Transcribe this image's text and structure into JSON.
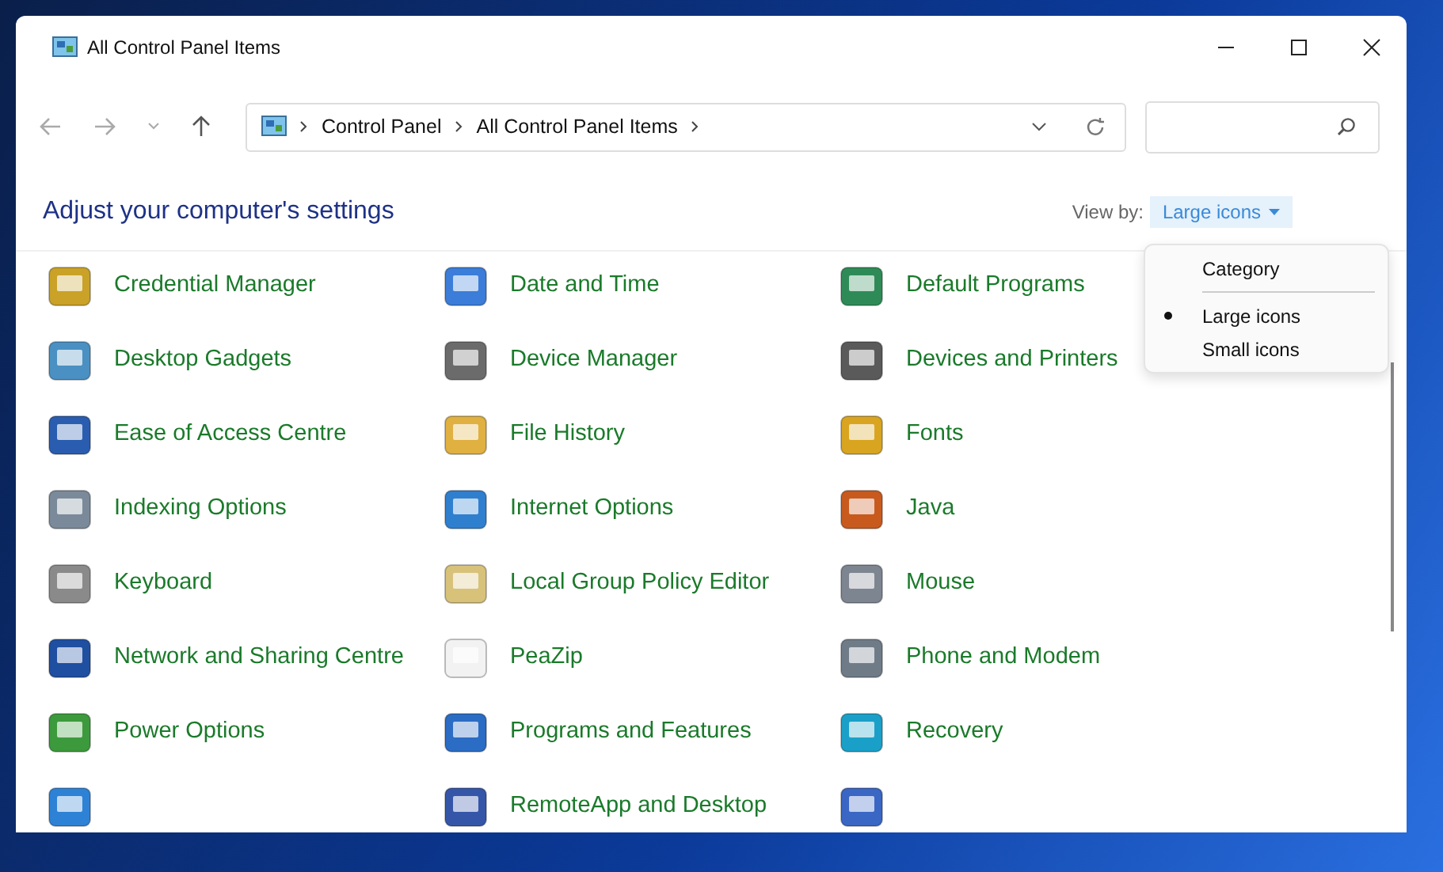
{
  "window": {
    "title": "All Control Panel Items"
  },
  "address_bar": {
    "breadcrumbs": [
      "Control Panel",
      "All Control Panel Items"
    ]
  },
  "header": {
    "title": "Adjust your computer's settings",
    "view_by_label": "View by:",
    "view_by_value": "Large icons"
  },
  "view_menu": {
    "expanded": true,
    "options": [
      {
        "label": "Category",
        "selected": false
      },
      {
        "label": "Large icons",
        "selected": true
      },
      {
        "label": "Small icons",
        "selected": false
      }
    ]
  },
  "items": [
    {
      "label": "Credential Manager"
    },
    {
      "label": "Date and Time"
    },
    {
      "label": "Default Programs"
    },
    {
      "label": "Desktop Gadgets"
    },
    {
      "label": "Device Manager"
    },
    {
      "label": "Devices and Printers"
    },
    {
      "label": "Ease of Access Centre"
    },
    {
      "label": "File History"
    },
    {
      "label": "Fonts"
    },
    {
      "label": "Indexing Options"
    },
    {
      "label": "Internet Options"
    },
    {
      "label": "Java"
    },
    {
      "label": "Keyboard"
    },
    {
      "label": "Local Group Policy Editor"
    },
    {
      "label": "Mouse"
    },
    {
      "label": "Network and Sharing Centre"
    },
    {
      "label": "PeaZip"
    },
    {
      "label": "Phone and Modem"
    },
    {
      "label": "Power Options"
    },
    {
      "label": "Programs and Features"
    },
    {
      "label": "Recovery"
    },
    {
      "kind": "cut_off"
    },
    {
      "kind": "applet",
      "label": "RemoteApp and Desktop"
    },
    {
      "kind": "cut_off"
    }
  ]
}
